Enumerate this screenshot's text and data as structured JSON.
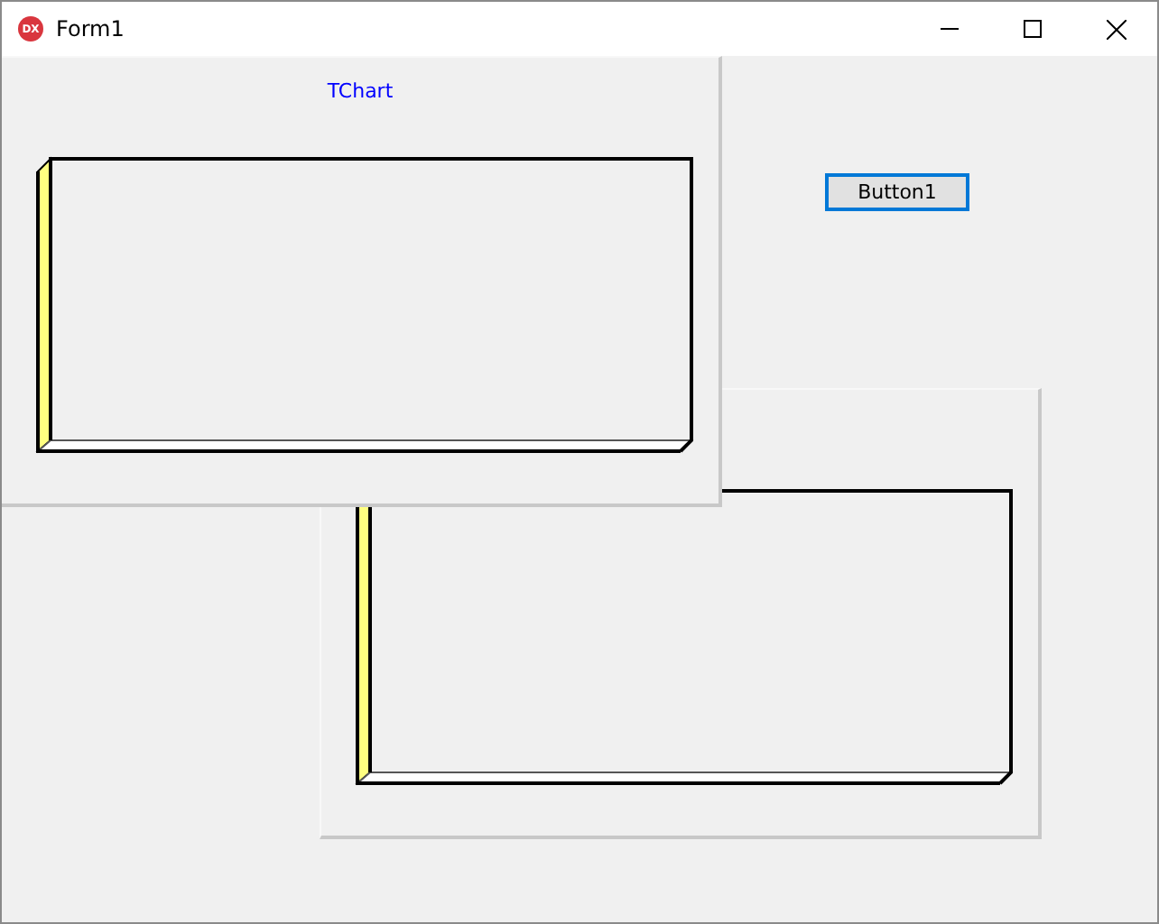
{
  "window": {
    "title": "Form1",
    "icon_text": "DX"
  },
  "charts": [
    {
      "kind": "titled",
      "title": "TChart"
    },
    {
      "kind": "plain"
    }
  ],
  "button": {
    "label": "Button1",
    "focused": true
  }
}
